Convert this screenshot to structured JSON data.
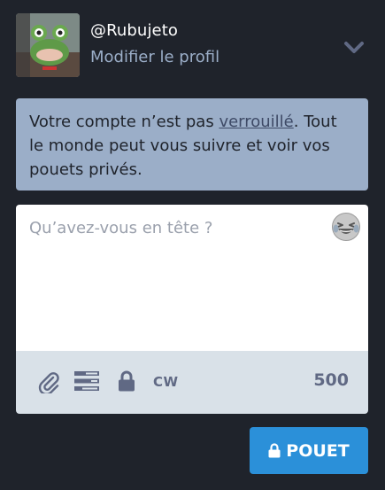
{
  "account": {
    "handle": "@Rubujeto",
    "edit_profile_label": "Modifier le profil"
  },
  "notice": {
    "text_before": "Votre compte n’est pas ",
    "link_text": "verrouillé",
    "text_after": ". Tout le monde peut vous suivre et voir vos pouets privés."
  },
  "composer": {
    "placeholder": "Qu’avez-vous en tête ?",
    "value": "",
    "emoji_icon": "grinning-squinting-emoji-icon",
    "toolbar": {
      "attach_icon": "paperclip-icon",
      "poll_icon": "poll-icon",
      "privacy_icon": "lock-icon",
      "cw_label": "CW",
      "char_counter": "500"
    }
  },
  "publish": {
    "label": "POUET",
    "icon": "lock-icon"
  },
  "colors": {
    "background": "#1f232b",
    "notice_bg": "#9baec8",
    "toolbar_bg": "#d9e1e8",
    "accent": "#2b90d9"
  }
}
